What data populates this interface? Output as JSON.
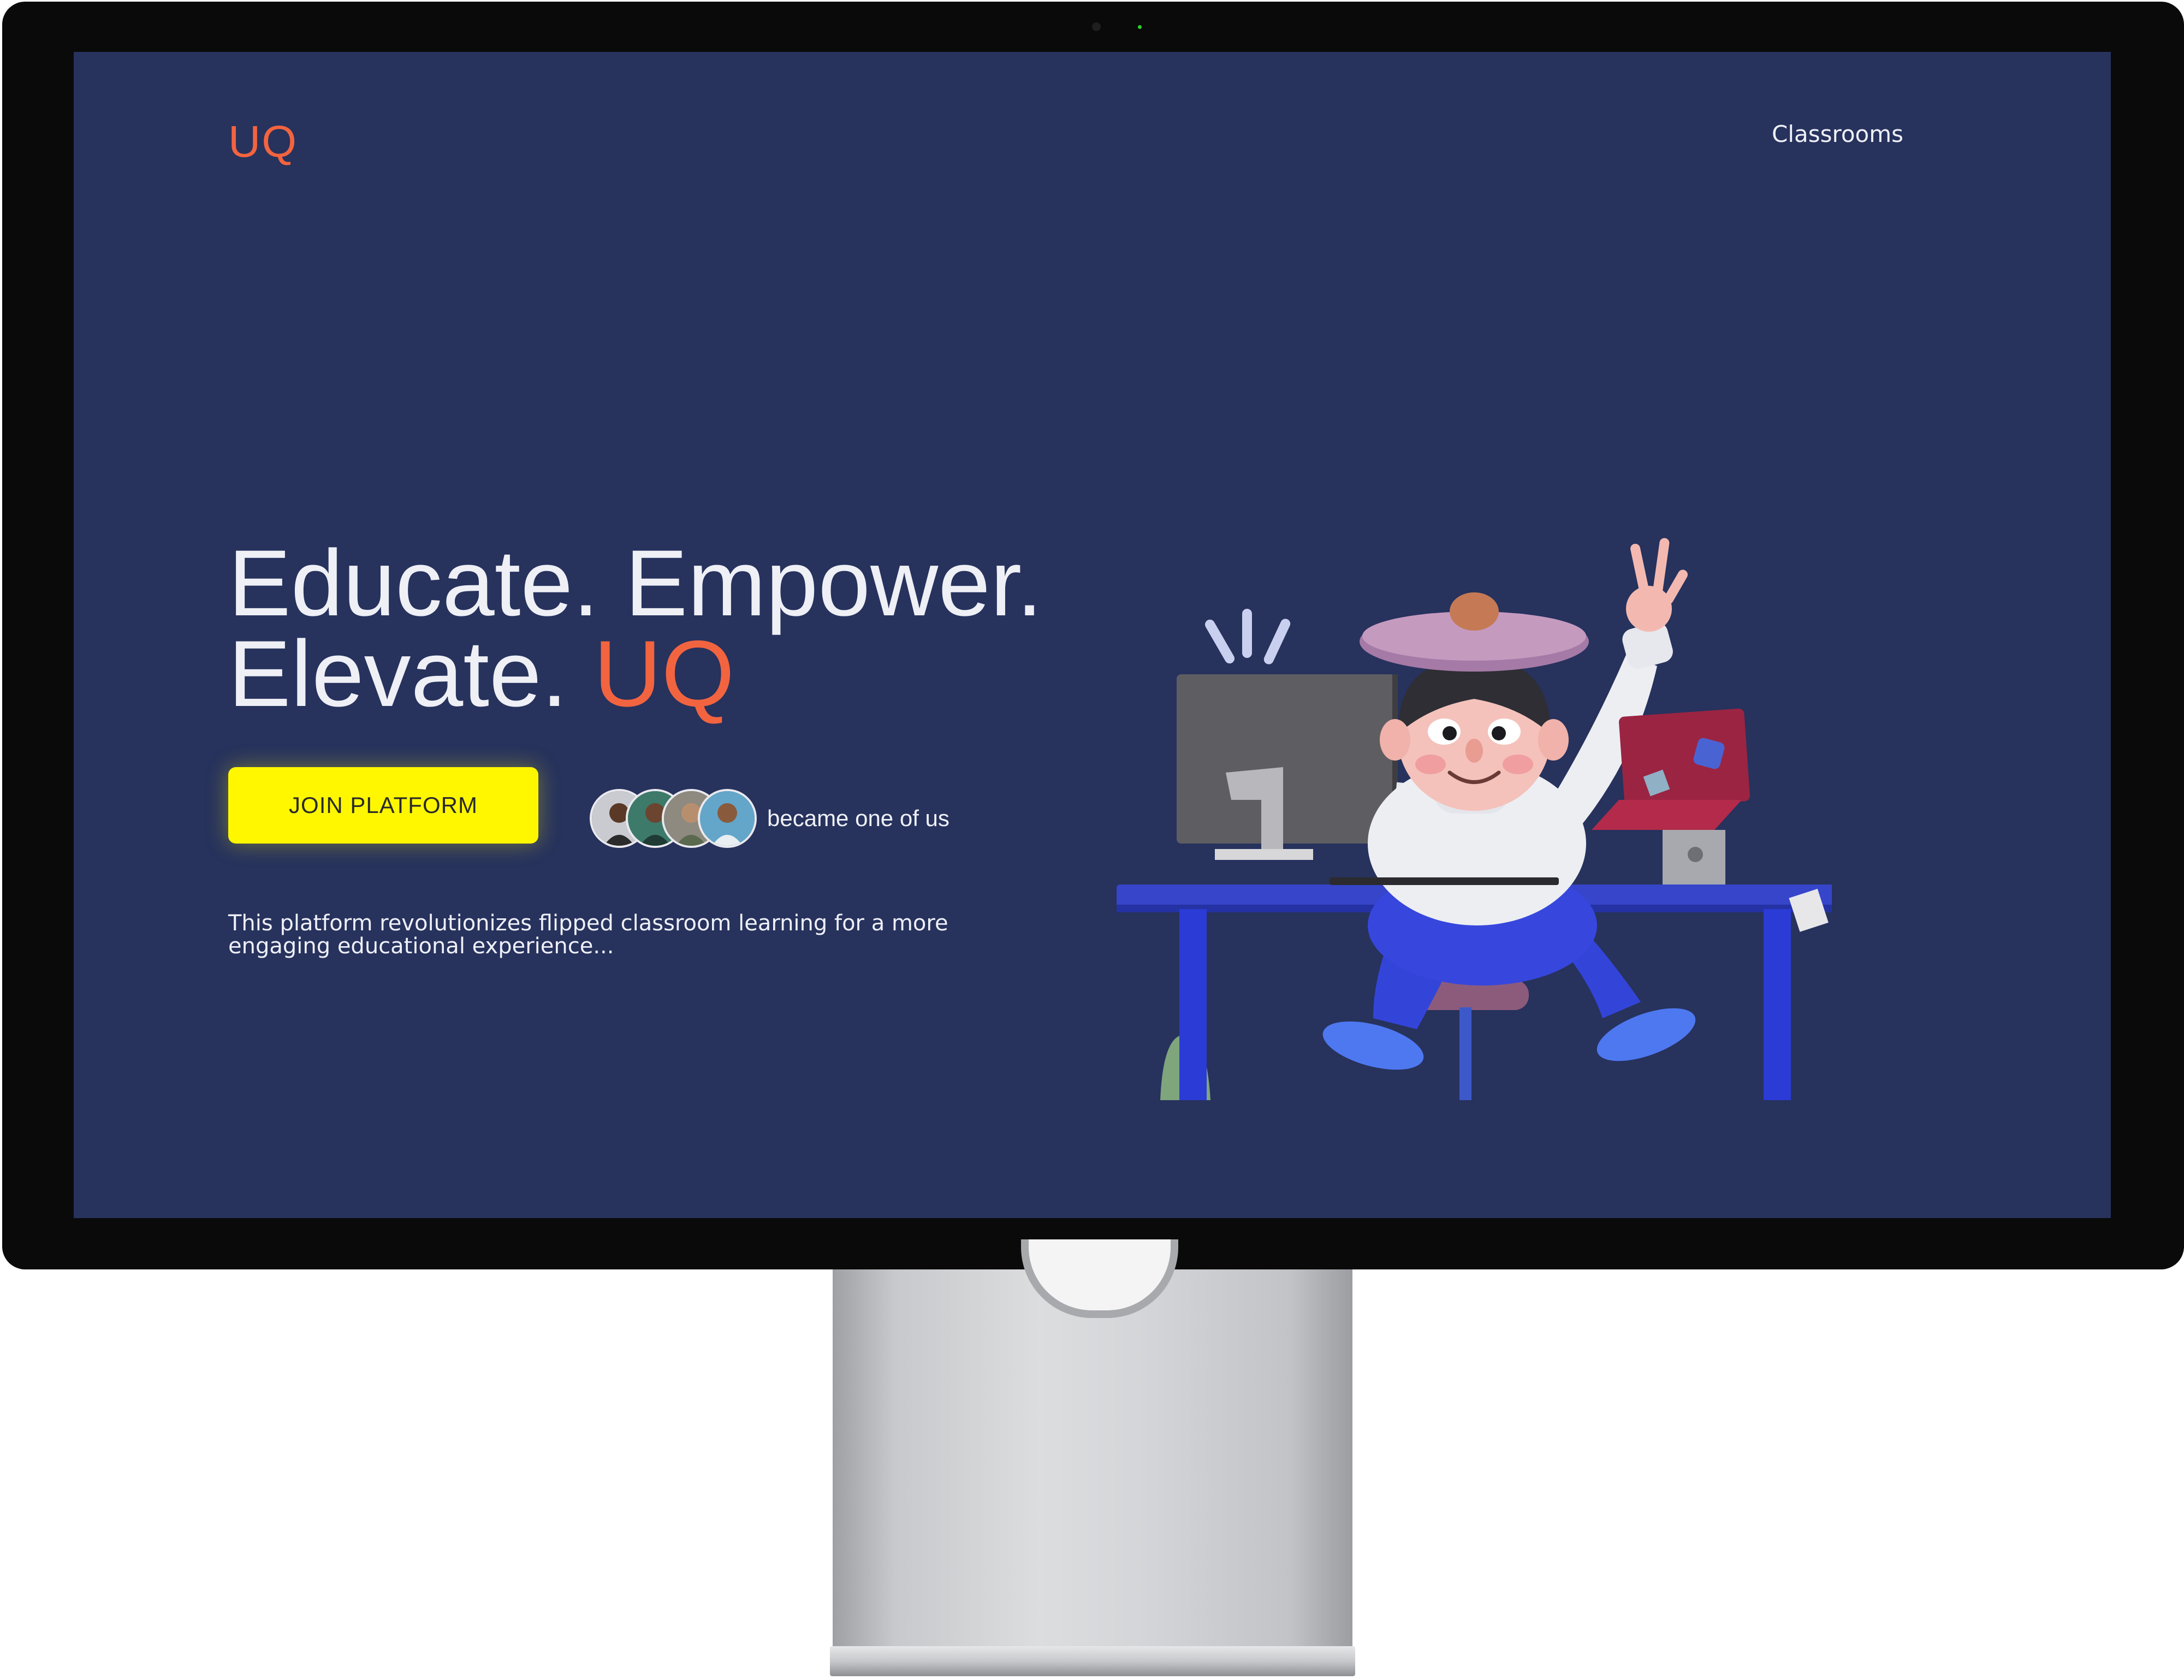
{
  "logo": {
    "text": "UQ"
  },
  "nav": {
    "classrooms": "Classrooms"
  },
  "hero": {
    "headline_line1": "Educate. Empower.",
    "headline_line2_prefix": "Elevate. ",
    "headline_line2_accent": "UQ",
    "cta_label": "JOIN PLATFORM",
    "social_proof_text": "became one of us",
    "description": "This platform revolutionizes flipped classroom learning for a more engaging educational experience..."
  },
  "colors": {
    "background": "#27325d",
    "accent": "#f2643f",
    "cta": "#fff700",
    "text": "#eef0f7"
  },
  "icons": {
    "avatars": [
      "user-avatar-1",
      "user-avatar-2",
      "user-avatar-3",
      "user-avatar-4"
    ],
    "illustration": "3d-character-at-desk-illustration"
  }
}
